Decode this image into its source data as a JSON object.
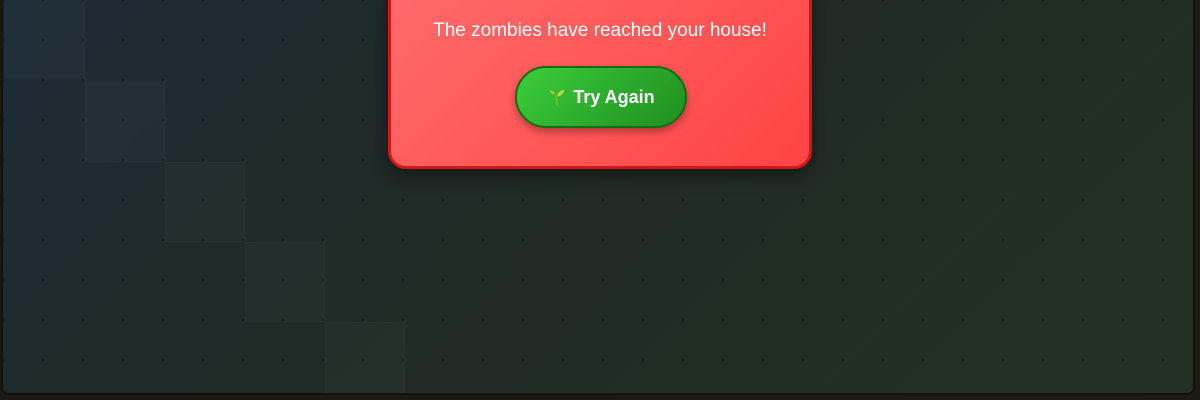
{
  "game_over": {
    "message": "The zombies have reached your house!",
    "button_label": "Try Again",
    "button_icon": "sprout-icon"
  },
  "colors": {
    "modal_background": "#ff5656",
    "modal_border": "#d41616",
    "button_background": "#2caa2c",
    "board_background": "#1f2b26"
  }
}
